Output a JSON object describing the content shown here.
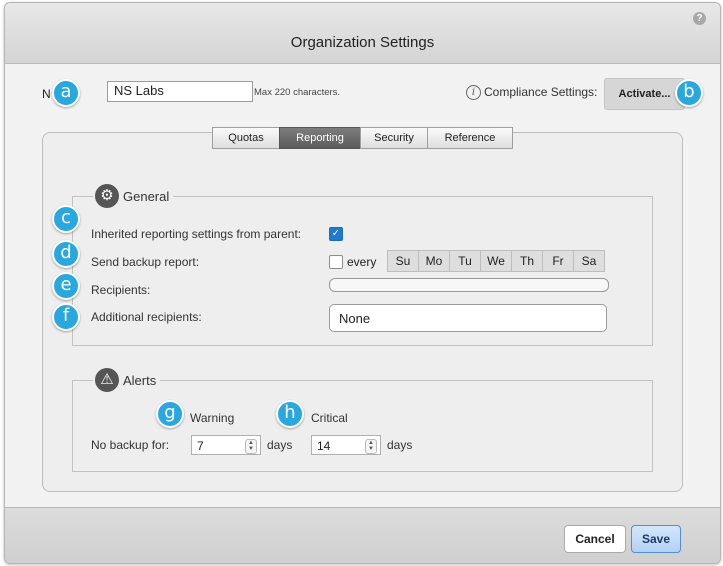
{
  "window": {
    "title": "Organization Settings",
    "help_icon": "?"
  },
  "badges": {
    "a": "a",
    "b": "b",
    "c": "c",
    "d": "d",
    "e": "e",
    "f": "f",
    "g": "g",
    "h": "h"
  },
  "name": {
    "label": "N",
    "value": "NS Labs",
    "hint": "Max 220 characters."
  },
  "compliance": {
    "info_icon": "i",
    "label": "Compliance Settings:",
    "button": "Activate..."
  },
  "tabs": [
    {
      "label": "Quotas",
      "active": false
    },
    {
      "label": "Reporting",
      "active": true
    },
    {
      "label": "Security",
      "active": false
    },
    {
      "label": "Reference",
      "active": false
    }
  ],
  "general": {
    "legend": "General",
    "icon": "gear-icon",
    "inherited_label": "Inherited reporting settings from parent:",
    "inherited_checked": true,
    "send_label": "Send backup report:",
    "send_checked": false,
    "every_label": "every",
    "days": [
      "Su",
      "Mo",
      "Tu",
      "We",
      "Th",
      "Fr",
      "Sa"
    ],
    "recipients_label": "Recipients:",
    "recipients_value": "",
    "additional_label": "Additional recipients:",
    "additional_value": "None"
  },
  "alerts": {
    "legend": "Alerts",
    "icon": "warning-icon",
    "warning_label": "Warning",
    "critical_label": "Critical",
    "no_backup_label": "No backup for:",
    "warning_value": "7",
    "critical_value": "14",
    "days_unit": "days"
  },
  "footer": {
    "cancel": "Cancel",
    "save": "Save"
  },
  "colors": {
    "badge": "#29a8e0",
    "tab_active": "#666666",
    "save_border": "#4f8fd4",
    "checkbox": "#1f78d1"
  }
}
